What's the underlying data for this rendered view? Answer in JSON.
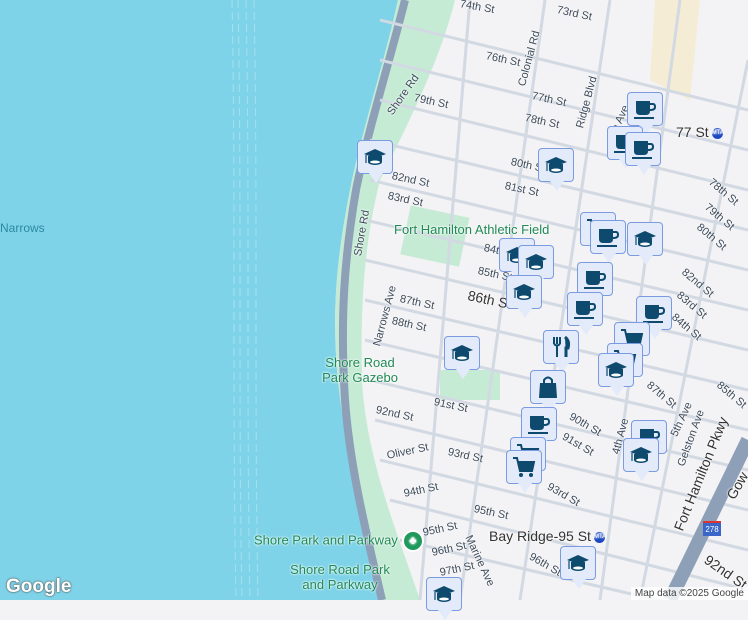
{
  "map": {
    "water_label": "Narrows",
    "parks": [
      "Fort Hamilton Athletic Field",
      "Shore Road Park Gazebo",
      "Shore Park and Parkway",
      "Shore Road Park and Parkway"
    ],
    "streets": [
      "74th St",
      "73rd St",
      "76th St",
      "Colonial Rd",
      "Shore Rd",
      "79th St",
      "77th St",
      "Ridge Blvd",
      "78th St",
      "80th St",
      "81st St",
      "82nd St",
      "83rd St",
      "Shore Rd",
      "84th St",
      "85th St",
      "86th St",
      "87th St",
      "Narrows Ave",
      "88th St",
      "91st St",
      "92nd St",
      "Oliver St",
      "93rd St",
      "94th St",
      "95th St",
      "95th St",
      "96th St",
      "97th St",
      "Marine Ave",
      "90th St",
      "91st St",
      "93rd St",
      "4th Ave",
      "78th St",
      "79th St",
      "80th St",
      "82nd St",
      "83rd St",
      "84th St",
      "87th St",
      "85th St",
      "4th Ave",
      "5th Ave",
      "Gelston Ave",
      "Fort Hamilton Pkwy",
      "92nd St",
      "96th St",
      "Gow"
    ],
    "transit": [
      "77 St",
      "Bay Ridge-95 St"
    ],
    "transit_icon": "subway-icon",
    "highway_shield": "278",
    "google_logo": "Google",
    "attribution": "Map data ©2025 Google"
  },
  "markers": [
    "school",
    "school",
    "coffee",
    "coffee",
    "coffee",
    "cart",
    "coffee",
    "school",
    "school",
    "school",
    "school",
    "coffee",
    "coffee",
    "restaurant",
    "coffee",
    "cart",
    "cart",
    "school",
    "school",
    "bag",
    "coffee",
    "cart",
    "cart",
    "coffee",
    "school",
    "school",
    "school"
  ],
  "colors": {
    "water": "#7fd3e8",
    "park": "#c5ebd4",
    "road": "#c9d2dc",
    "highway": "#8e9fb8",
    "marker_bg": "#e3ebfb",
    "marker_icon": "#0d4a6e"
  }
}
